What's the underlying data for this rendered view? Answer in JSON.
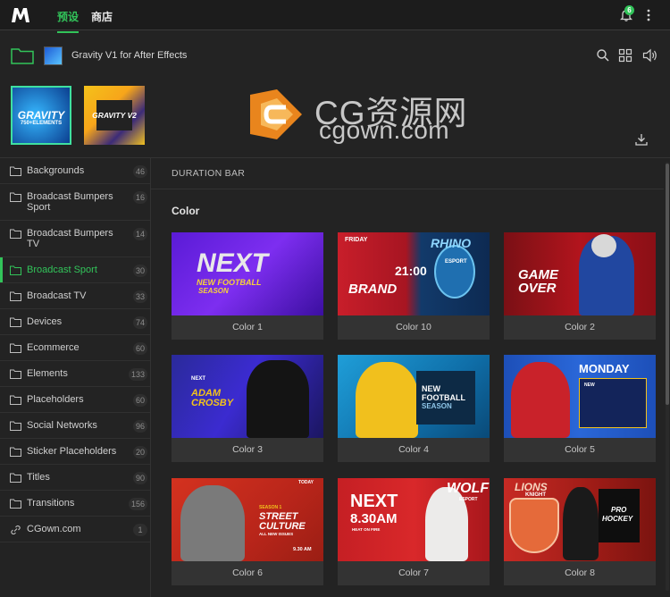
{
  "topbar": {
    "tabs": [
      {
        "label": "预设"
      },
      {
        "label": "商店"
      }
    ],
    "notification_count": "6"
  },
  "header": {
    "product_title": "Gravity V1 for After Effects"
  },
  "presets": [
    {
      "line1": "GRAVITY",
      "line2": "750+ELEMENTS"
    },
    {
      "line1": "GRAVITY V2"
    }
  ],
  "watermark": {
    "title": "CG资源网",
    "domain": "cgown.com"
  },
  "sidebar": {
    "items": [
      {
        "label": "Backgrounds",
        "count": "46"
      },
      {
        "label": "Broadcast Bumpers Sport",
        "count": "16"
      },
      {
        "label": "Broadcast Bumpers TV",
        "count": "14"
      },
      {
        "label": "Broadcast Sport",
        "count": "30"
      },
      {
        "label": "Broadcast TV",
        "count": "33"
      },
      {
        "label": "Devices",
        "count": "74"
      },
      {
        "label": "Ecommerce",
        "count": "60"
      },
      {
        "label": "Elements",
        "count": "133"
      },
      {
        "label": "Placeholders",
        "count": "60"
      },
      {
        "label": "Social Networks",
        "count": "96"
      },
      {
        "label": "Sticker Placeholders",
        "count": "20"
      },
      {
        "label": "Titles",
        "count": "90"
      },
      {
        "label": "Transitions",
        "count": "156"
      },
      {
        "label": "CGown.com",
        "count": "1"
      }
    ]
  },
  "main": {
    "section": "DURATION BAR",
    "subsection": "Color",
    "cards": [
      {
        "caption": "Color 1",
        "art": [
          "NEXT",
          "NEW FOOTBALL",
          "SEASON"
        ]
      },
      {
        "caption": "Color 10",
        "art": [
          "FRIDAY",
          "21:00",
          "BRAND",
          "RHINO",
          "ESPORT"
        ]
      },
      {
        "caption": "Color 2",
        "art": [
          "GAME",
          "OVER"
        ]
      },
      {
        "caption": "Color 3",
        "art": [
          "NEXT",
          "ADAM",
          "CROSBY"
        ]
      },
      {
        "caption": "Color 4",
        "art": [
          "NEW",
          "FOOTBALL",
          "SEASON"
        ]
      },
      {
        "caption": "Color 5",
        "art": [
          "MONDAY",
          "NEW"
        ]
      },
      {
        "caption": "Color 6",
        "art": [
          "TODAY",
          "SEASON 1",
          "STREET",
          "CULTURE",
          "ALL NEW ISSUES",
          "9.30 AM"
        ]
      },
      {
        "caption": "Color 7",
        "art": [
          "NEXT",
          "8.30AM",
          "HEAT ON FIRE",
          "WOLF",
          "ESPORT"
        ]
      },
      {
        "caption": "Color 8",
        "art": [
          "LIONS",
          "KNIGHT",
          "PRO",
          "HOCKEY"
        ]
      }
    ]
  },
  "colors": {
    "accent": "#32c45a",
    "background": "#232323",
    "topbar": "#1c1c1c"
  }
}
